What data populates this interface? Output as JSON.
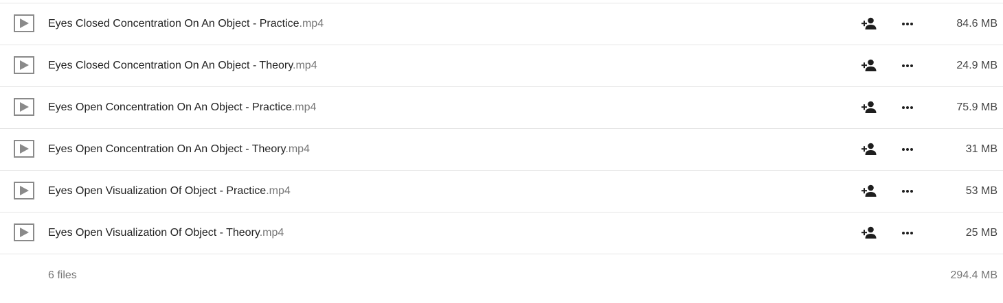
{
  "files": [
    {
      "name": "Eyes Closed Concentration On An Object - Practice",
      "ext": ".mp4",
      "size": "84.6 MB",
      "icon": "video-play-icon"
    },
    {
      "name": "Eyes Closed Concentration On An Object - Theory",
      "ext": ".mp4",
      "size": "24.9 MB",
      "icon": "video-play-icon"
    },
    {
      "name": "Eyes Open Concentration On An Object - Practice",
      "ext": ".mp4",
      "size": "75.9 MB",
      "icon": "video-play-icon"
    },
    {
      "name": "Eyes Open Concentration On An Object - Theory",
      "ext": ".mp4",
      "size": "31 MB",
      "icon": "video-play-icon"
    },
    {
      "name": "Eyes Open Visualization Of Object - Practice",
      "ext": ".mp4",
      "size": "53 MB",
      "icon": "video-play-icon"
    },
    {
      "name": "Eyes Open Visualization Of Object - Theory",
      "ext": ".mp4",
      "size": "25 MB",
      "icon": "video-play-icon"
    }
  ],
  "row_actions": {
    "share_icon": "add-person-icon",
    "more_icon": "more-horizontal-icon"
  },
  "summary": {
    "count": "6 files",
    "total_size": "294.4 MB"
  },
  "colors": {
    "divider": "#e5e5e5",
    "text": "#222222",
    "muted": "#767676",
    "icon_gray": "#8a8a8a",
    "action_icon": "#1e1e1e"
  }
}
